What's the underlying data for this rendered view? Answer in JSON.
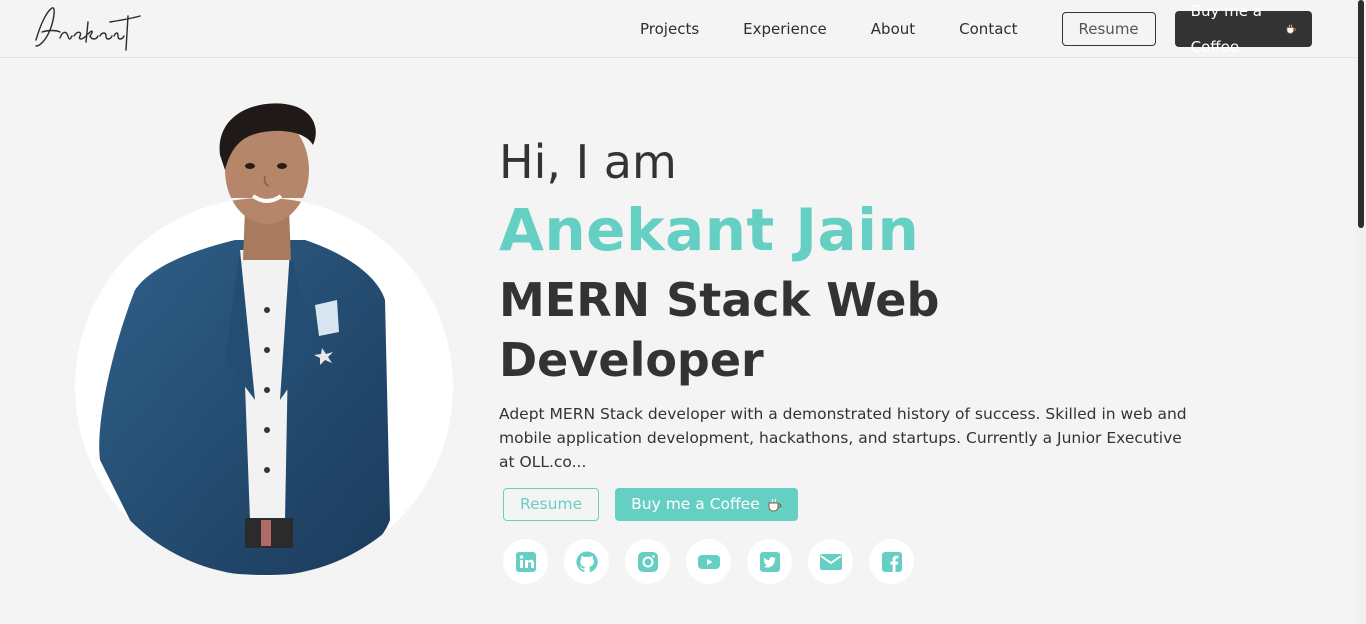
{
  "brand": {
    "logo_text": "Anekant"
  },
  "nav": {
    "links": [
      "Projects",
      "Experience",
      "About",
      "Contact"
    ],
    "resume_label": "Resume",
    "coffee_label": "Buy me a Coffee"
  },
  "hero": {
    "greeting": "Hi, I am",
    "name": "Anekant Jain",
    "role": "MERN Stack Web Developer",
    "bio": "Adept MERN Stack developer with a demonstrated history of success. Skilled in web and mobile application development, hackathons, and startups. Currently a Junior Executive at OLL.co...",
    "resume_label": "Resume",
    "coffee_label": "Buy me a Coffee"
  },
  "socials": [
    {
      "icon": "linkedin-icon"
    },
    {
      "icon": "github-icon"
    },
    {
      "icon": "instagram-icon"
    },
    {
      "icon": "youtube-icon"
    },
    {
      "icon": "twitter-icon"
    },
    {
      "icon": "mail-icon"
    },
    {
      "icon": "facebook-icon"
    }
  ],
  "colors": {
    "accent": "#66cfc4",
    "dark": "#333333",
    "background": "#f4f4f4"
  }
}
